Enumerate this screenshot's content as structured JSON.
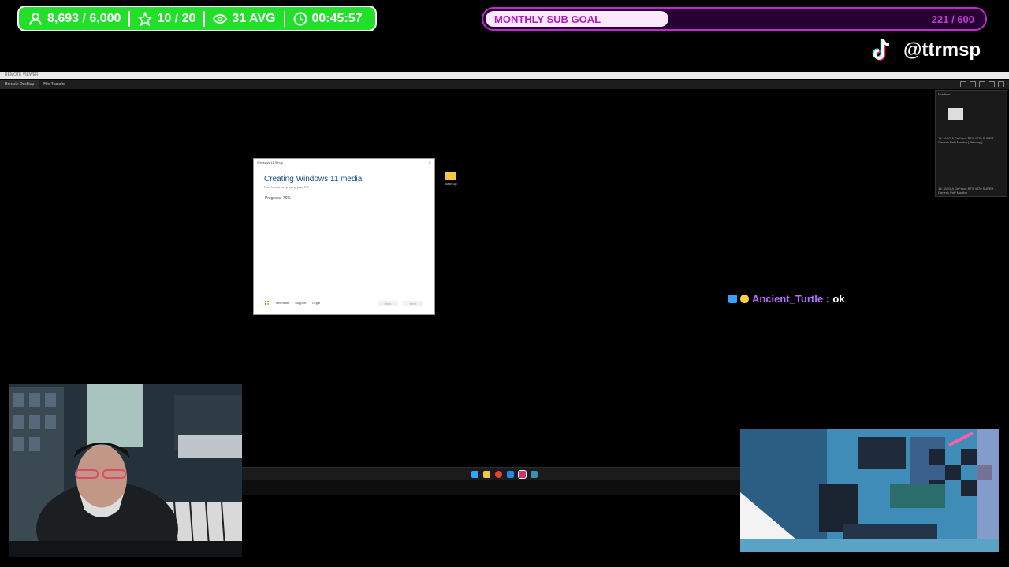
{
  "stats": {
    "followers": "8,693 / 6,000",
    "stars": "10 / 20",
    "viewers": "31 AVG",
    "uptime": "00:45:57"
  },
  "goal": {
    "label": "MONTHLY SUB GOAL",
    "count": "221 / 600",
    "progress": 0.3683
  },
  "tiktok": {
    "handle": "@ttrmsp"
  },
  "remote": {
    "title": "REMOTE VIEWER",
    "tabs": [
      "Remote Desktop",
      "File Transfer"
    ]
  },
  "monitors": {
    "title": "Monitors",
    "items": [
      "1#: NVIDIA GeForce RTX 4070 SUPER - Generic PnP Monitor [ Primary ]",
      "1#: NVIDIA GeForce RTX 4070 SUPER - Generic PnP Monitor"
    ]
  },
  "dialog": {
    "title": "Windows 11 Setup",
    "heading": "Creating Windows 11 media",
    "subtitle": "Feel free to keep using your PC.",
    "progress": "Progress: 76%",
    "links": [
      "Microsoft",
      "Support",
      "Legal"
    ],
    "buttons": [
      "Back",
      "Next"
    ]
  },
  "desktop": {
    "folder_label": "Back Up"
  },
  "chat": {
    "user": "Ancient_Turtle",
    "sep": ":",
    "message": "ok"
  },
  "colors": {
    "stats_green": "#22e02a",
    "goal_purple": "#c22ad0",
    "chat_name": "#b66cff"
  }
}
